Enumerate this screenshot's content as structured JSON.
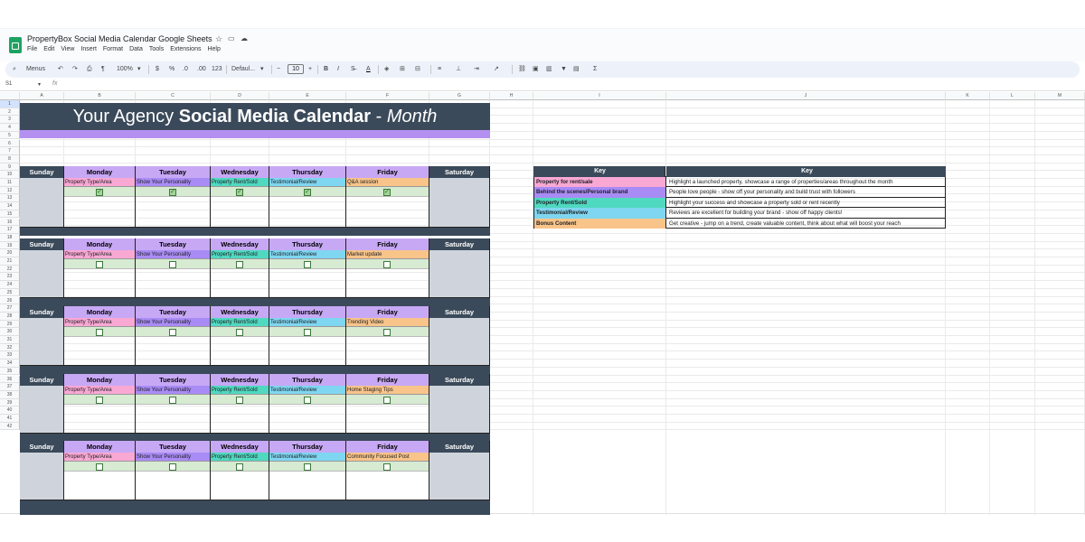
{
  "app": {
    "doc_title": "PropertyBox Social Media Calendar Google Sheets",
    "menu": [
      "File",
      "Edit",
      "View",
      "Insert",
      "Format",
      "Data",
      "Tools",
      "Extensions",
      "Help"
    ]
  },
  "toolbar": {
    "menus": "Menus",
    "zoom": "100%",
    "currency": "$",
    "percent": "%",
    "decrease_decimal": ".0",
    "increase_decimal": ".00",
    "number_format": "123",
    "font": "Defaul...",
    "font_size": "10",
    "minus": "−",
    "plus": "+",
    "bold": "B",
    "italic": "I"
  },
  "formula": {
    "cell_ref": "S1",
    "fx": "fx"
  },
  "columns": [
    "A",
    "B",
    "C",
    "D",
    "E",
    "F",
    "G",
    "H",
    "I",
    "J",
    "K",
    "L",
    "M"
  ],
  "rows": [
    "1",
    "2",
    "3",
    "4",
    "5",
    "6",
    "7",
    "8",
    "9",
    "10",
    "11",
    "12",
    "13",
    "14",
    "15",
    "16",
    "17",
    "18",
    "19",
    "20",
    "21",
    "22",
    "23",
    "24",
    "25",
    "26",
    "27",
    "28",
    "29",
    "30",
    "31",
    "32",
    "33",
    "34",
    "35",
    "36",
    "37",
    "38",
    "39",
    "40",
    "41",
    "42"
  ],
  "banner": {
    "part1": "Your Agency ",
    "part2": "Social Media Calendar",
    "part3": " - ",
    "part4": "Month"
  },
  "days": [
    "Sunday",
    "Monday",
    "Tuesday",
    "Wednesday",
    "Thursday",
    "Friday",
    "Saturday"
  ],
  "weeks": [
    {
      "categories": [
        "Property Type/Area",
        "Show Your Personality",
        "Property Rent/Sold",
        "Testimonial/Review",
        "Q&A session"
      ],
      "checked": [
        true,
        true,
        true,
        true,
        true
      ]
    },
    {
      "categories": [
        "Property Type/Area",
        "Show Your Personality",
        "Property Rent/Sold",
        "Testimonial/Review",
        "Market update"
      ],
      "checked": [
        false,
        false,
        false,
        false,
        false
      ]
    },
    {
      "categories": [
        "Property Type/Area",
        "Show Your Personality",
        "Property Rent/Sold",
        "Testimonial/Review",
        "Trending Video"
      ],
      "checked": [
        false,
        false,
        false,
        false,
        false
      ]
    },
    {
      "categories": [
        "Property Type/Area",
        "Show Your Personality",
        "Property Rent/Sold",
        "Testimonial/Review",
        "Home Staging Tips"
      ],
      "checked": [
        false,
        false,
        false,
        false,
        false
      ]
    },
    {
      "categories": [
        "Property Type/Area",
        "Show Your Personality",
        "Property Rent/Sold",
        "Testimonial/Review",
        "Community Focused Post"
      ],
      "checked": [
        false,
        false,
        false,
        false,
        false
      ]
    }
  ],
  "category_colors": [
    "#f9a8d4",
    "#a98bf5",
    "#4fd9c0",
    "#7fd6f0",
    "#f8c48a"
  ],
  "key": {
    "header_left": "Key",
    "header_right": "Key",
    "rows": [
      {
        "name": "Property for rent/sale",
        "desc": "Highlight a launched property, showcase a range of properties/areas throughout the month",
        "color": "#f9a8d4"
      },
      {
        "name": "Behind the scenes/Personal brand",
        "desc": "People love people - show off your personality and build trust with followers",
        "color": "#a98bf5"
      },
      {
        "name": "Property Rent/Sold",
        "desc": "Highlight your success and showcase a property sold or rent recently",
        "color": "#4fd9c0"
      },
      {
        "name": "Testimonial/Review",
        "desc": "Reviews are excellent for building your brand - show off happy clients!",
        "color": "#7fd6f0"
      },
      {
        "name": "Bonus Content",
        "desc": "Get creative - jump on a trend, create valuable content, think about what will boost your reach",
        "color": "#f8c48a"
      }
    ]
  }
}
